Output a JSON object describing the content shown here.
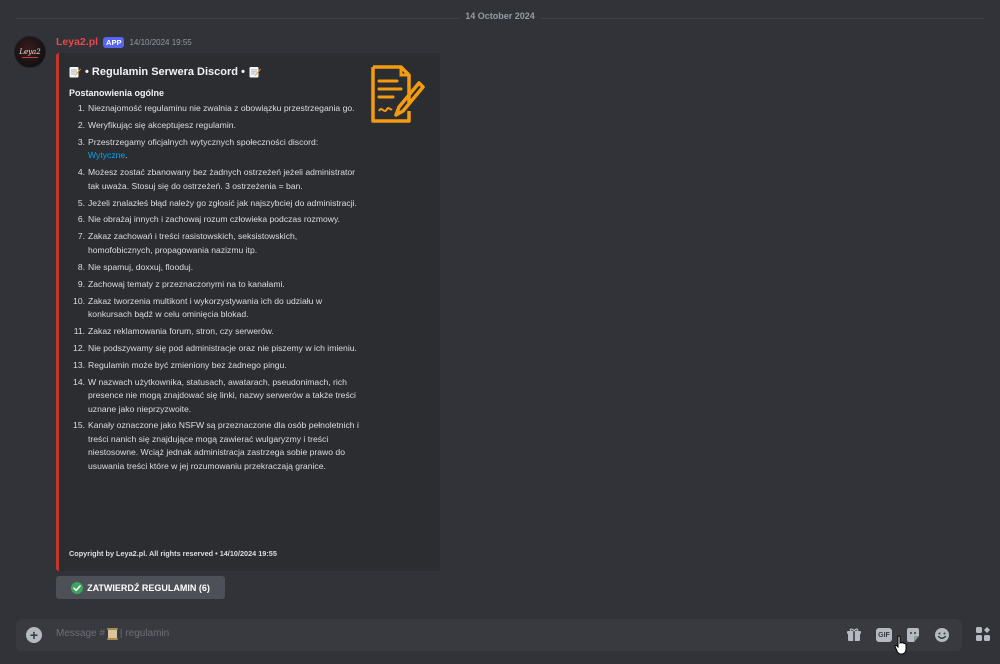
{
  "date_divider": "14 October 2024",
  "message": {
    "username": "Leya2.pl",
    "badge": "APP",
    "timestamp": "14/10/2024 19:55",
    "avatar_text": "Leya2"
  },
  "embed": {
    "title": "• Regulamin Serwera Discord •",
    "subtitle": "Postanowienia ogólne",
    "footer": "Copyright by Leya2.pl. All rights reserved • 14/10/2024 19:55",
    "accent_color": "#c0392b",
    "rules": [
      {
        "num": "1.",
        "text": "Nieznajomość regulaminu nie zwalnia z obowiązku przestrzegania go."
      },
      {
        "num": "2.",
        "text": "Weryfikując się akceptujesz regulamin."
      },
      {
        "num": "3.",
        "text": "Przestrzegamy oficjalnych wytycznych społeczności discord:",
        "link": "Wytyczne",
        "after": "."
      },
      {
        "num": "4.",
        "text": "Możesz zostać zbanowany bez żadnych ostrzeżeń jeżeli administrator tak uważa. Stosuj się do ostrzeżeń. 3 ostrzeżenia = ban."
      },
      {
        "num": "5.",
        "text": "Jeżeli znalazłeś błąd należy go zgłosić jak najszybciej do administracji."
      },
      {
        "num": "6.",
        "text": "Nie obrażaj innych i zachowaj rozum człowieka podczas rozmowy."
      },
      {
        "num": "7.",
        "text": "Zakaz zachowań i treści rasistowskich, seksistowskich, homofobicznych, propagowania nazizmu itp."
      },
      {
        "num": "8.",
        "text": "Nie spamuj, doxxuj, flooduj."
      },
      {
        "num": "9.",
        "text": "Zachowaj tematy z przeznaczonymi na to kanałami."
      },
      {
        "num": "10.",
        "text": "Zakaz tworzenia multikont i wykorzystywania ich do udziału w konkursach bądź w celu ominięcia blokad."
      },
      {
        "num": "11.",
        "text": "Zakaz reklamowania forum, stron, czy serwerów."
      },
      {
        "num": "12.",
        "text": "Nie podszywamy się pod administracje oraz nie piszemy w ich imieniu."
      },
      {
        "num": "13.",
        "text": "Regulamin może być zmieniony bez żadnego pingu."
      },
      {
        "num": "14.",
        "text": "W nazwach użytkownika, statusach, awatarach, pseudonimach, rich presence nie mogą znajdować się linki, nazwy serwerów a także treści uznane jako nieprzyzwoite."
      },
      {
        "num": "15.",
        "text": "Kanały oznaczone jako NSFW są przeznaczone dla osób pełnoletnich i treści nanich się znajdujące mogą zawierać wulgaryzmy i treści niestosowne. Wciąż jednak administracja zastrzega sobie prawo do usuwania treści które w jej rozumowaniu przekraczają granice."
      }
    ]
  },
  "button": {
    "label": "ZATWIERDŹ REGULAMIN (6)"
  },
  "composer": {
    "placeholder_prefix": "Message #",
    "channel": "| regulamin",
    "gif_label": "GIF"
  },
  "colors": {
    "background": "#313338",
    "embed_bg": "#2b2d31",
    "username": "#e5484d",
    "badge": "#5865f2",
    "link": "#00a8fc",
    "thumbnail": "#f39c12"
  }
}
